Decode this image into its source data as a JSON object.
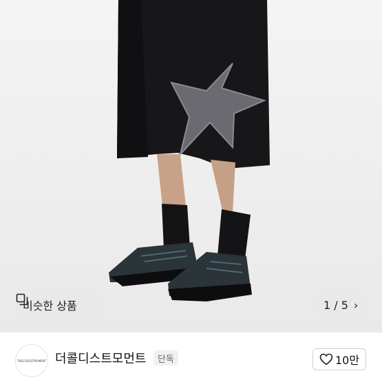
{
  "product_image": {
    "alt_icon": "product-photo"
  },
  "similar": {
    "label": "비슷한 상품",
    "icon": "similar-items-icon"
  },
  "gallery": {
    "counter": "1 / 5",
    "next_icon": "chevron-right-icon"
  },
  "brand": {
    "logo_text": "THECOLDSTMOMENT",
    "name": "더콜디스트모먼트",
    "badge": "단독"
  },
  "like": {
    "count": "10만",
    "icon": "heart-outline-icon"
  }
}
